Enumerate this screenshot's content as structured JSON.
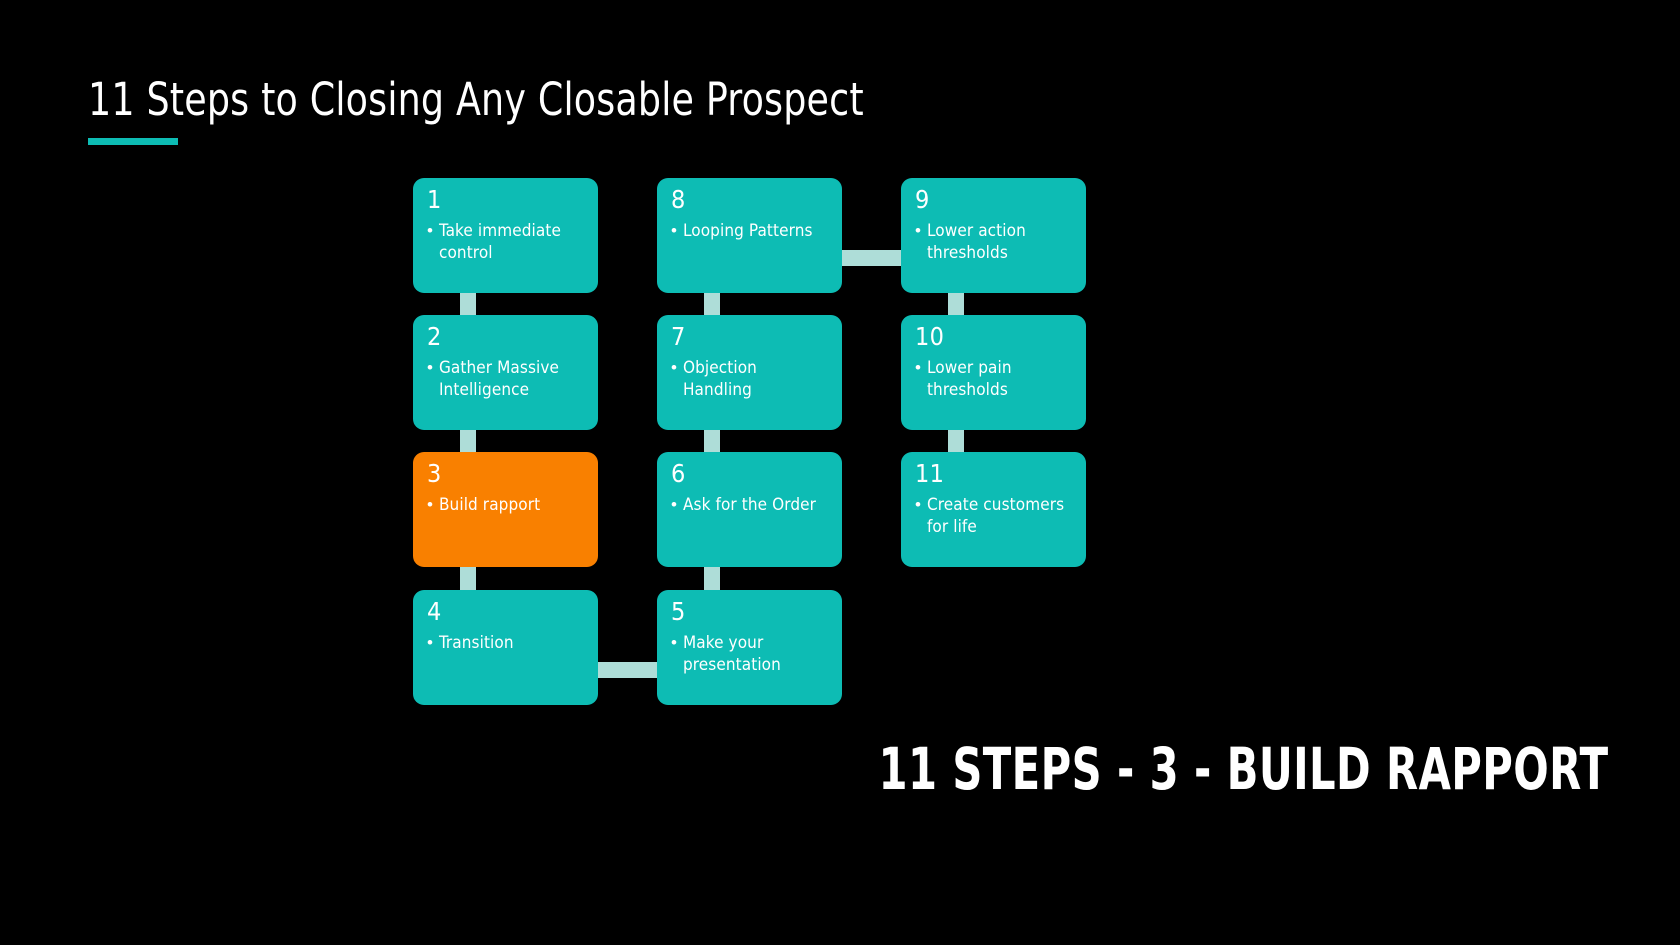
{
  "slide": {
    "background_color": "#000000",
    "title": "11 Steps to Closing Any Closable Prospect",
    "caption": "11 STEPS - 3 - BUILD RAPPORT",
    "accent_color": "#0DBCB4",
    "highlight_color": "#F98000",
    "connector_color": "#AEDDD8",
    "text_color": "#FFFFFF"
  },
  "diagram": {
    "type": "flow-grid",
    "columns": 3,
    "rows": 4,
    "nodes": [
      {
        "number": "1",
        "bullet": "•",
        "text": "Take immediate control",
        "color": "#0DBCB4",
        "highlighted": false,
        "col": 1,
        "row": 1
      },
      {
        "number": "2",
        "bullet": "•",
        "text": "Gather Massive Intelligence",
        "color": "#0DBCB4",
        "highlighted": false,
        "col": 1,
        "row": 2
      },
      {
        "number": "3",
        "bullet": "•",
        "text": "Build rapport",
        "color": "#F98000",
        "highlighted": true,
        "col": 1,
        "row": 3
      },
      {
        "number": "4",
        "bullet": "•",
        "text": "Transition",
        "color": "#0DBCB4",
        "highlighted": false,
        "col": 1,
        "row": 4
      },
      {
        "number": "8",
        "bullet": "•",
        "text": "Looping Patterns",
        "color": "#0DBCB4",
        "highlighted": false,
        "col": 2,
        "row": 1
      },
      {
        "number": "7",
        "bullet": "•",
        "text": "Objection Handling",
        "color": "#0DBCB4",
        "highlighted": false,
        "col": 2,
        "row": 2
      },
      {
        "number": "6",
        "bullet": "•",
        "text": "Ask for the Order",
        "color": "#0DBCB4",
        "highlighted": false,
        "col": 2,
        "row": 3
      },
      {
        "number": "5",
        "bullet": "•",
        "text": "Make your presentation",
        "color": "#0DBCB4",
        "highlighted": false,
        "col": 2,
        "row": 4
      },
      {
        "number": "9",
        "bullet": "•",
        "text": "Lower action thresholds",
        "color": "#0DBCB4",
        "highlighted": false,
        "col": 3,
        "row": 1
      },
      {
        "number": "10",
        "bullet": "•",
        "text": "Lower pain thresholds",
        "color": "#0DBCB4",
        "highlighted": false,
        "col": 3,
        "row": 2
      },
      {
        "number": "11",
        "bullet": "•",
        "text": "Create customers for life",
        "color": "#0DBCB4",
        "highlighted": false,
        "col": 3,
        "row": 3
      }
    ],
    "connectors": [
      {
        "from": "1",
        "to": "2",
        "orientation": "vertical"
      },
      {
        "from": "2",
        "to": "3",
        "orientation": "vertical"
      },
      {
        "from": "3",
        "to": "4",
        "orientation": "vertical"
      },
      {
        "from": "4",
        "to": "5",
        "orientation": "horizontal"
      },
      {
        "from": "5",
        "to": "6",
        "orientation": "vertical"
      },
      {
        "from": "6",
        "to": "7",
        "orientation": "vertical"
      },
      {
        "from": "7",
        "to": "8",
        "orientation": "vertical"
      },
      {
        "from": "8",
        "to": "9",
        "orientation": "horizontal"
      },
      {
        "from": "9",
        "to": "10",
        "orientation": "vertical"
      },
      {
        "from": "10",
        "to": "11",
        "orientation": "vertical"
      }
    ]
  }
}
